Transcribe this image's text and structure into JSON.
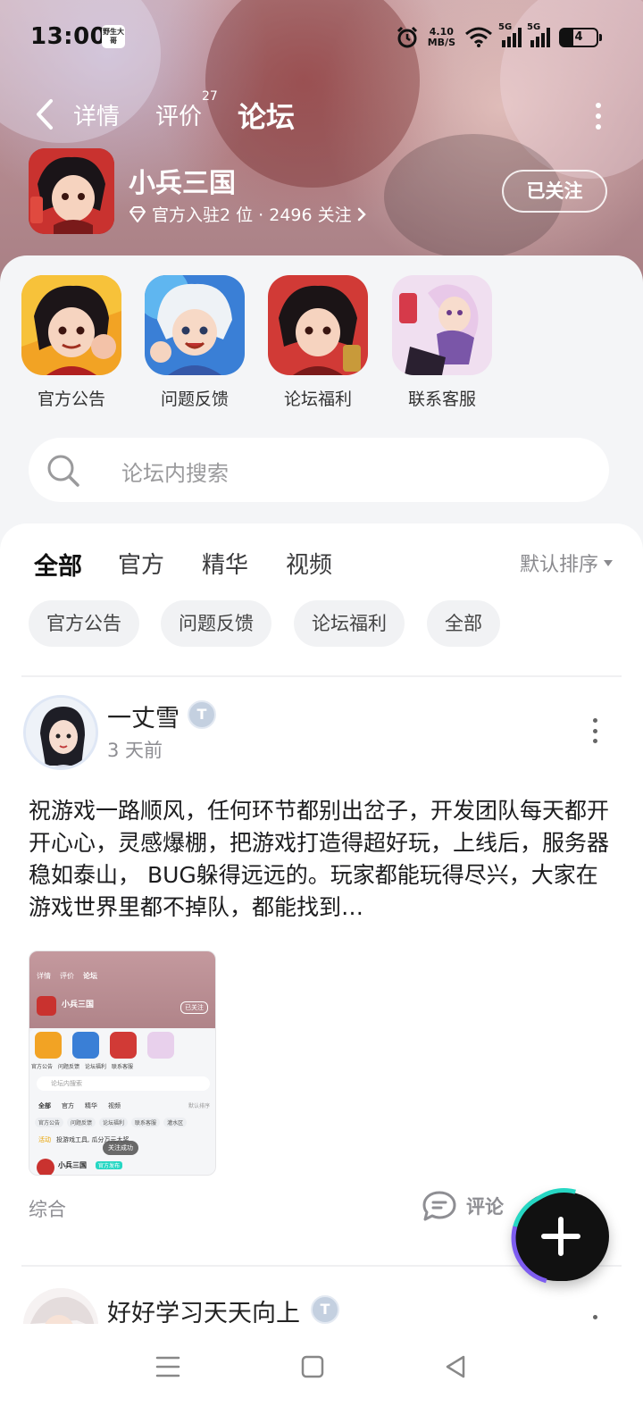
{
  "status_bar": {
    "time": "13:00",
    "app_icon_text": "野生大哥",
    "net_speed_value": "4.10",
    "net_speed_unit": "MB/S",
    "signal_1_tag": "5G",
    "signal_2_tag": "5G",
    "battery": "4"
  },
  "nav": {
    "tabs": [
      {
        "label": "详情"
      },
      {
        "label": "评价",
        "badge": "27"
      },
      {
        "label": "论坛"
      }
    ]
  },
  "game": {
    "title": "小兵三国",
    "meta": "官方入驻2 位 · 2496 关注",
    "follow_label": "已关注"
  },
  "shortcuts": [
    {
      "label": "官方公告",
      "icon": "hero-red-fist"
    },
    {
      "label": "问题反馈",
      "icon": "hero-white-hair"
    },
    {
      "label": "论坛福利",
      "icon": "hero-red-game-logo"
    },
    {
      "label": "联系客服",
      "icon": "hero-purple-girl"
    }
  ],
  "search": {
    "placeholder": "论坛内搜索"
  },
  "filters": {
    "tabs": [
      {
        "label": "全部"
      },
      {
        "label": "官方"
      },
      {
        "label": "精华"
      },
      {
        "label": "视频"
      }
    ],
    "sort_label": "默认排序",
    "chips": [
      {
        "label": "官方公告"
      },
      {
        "label": "问题反馈"
      },
      {
        "label": "论坛福利"
      },
      {
        "label": "全部"
      }
    ]
  },
  "posts": [
    {
      "author": "一丈雪",
      "time": "3 天前",
      "body": "祝游戏一路顺风，任何环节都别出岔子，开发团队每天都开开心心，灵感爆棚，把游戏打造得超好玩，上线后，服务器稳如泰山， BUG躲得远远的。玩家都能玩得尽兴，大家在游戏世界里都不掉队，都能找到…",
      "category": "综合",
      "comment_label": "评论",
      "thumb": {
        "title": "小兵三国",
        "tabs": [
          "详情",
          "评价",
          "论坛"
        ],
        "follow": "已关注",
        "shortcuts": [
          "官方公告",
          "问题反馈",
          "论坛福利",
          "联系客服"
        ],
        "search": "论坛内搜索",
        "filters": [
          "全部",
          "官方",
          "精华",
          "视频"
        ],
        "sort": "默认排序",
        "chips": [
          "官方公告",
          "问题反馈",
          "论坛福利",
          "联系客服",
          "灌水区"
        ],
        "activity_tag": "活动",
        "activity_text": "投游戏工具, 瓜分万元大奖",
        "toast": "关注成功",
        "row_author": "小兵三国",
        "row_badge": "官方发布"
      }
    },
    {
      "author": "好好学习天天向上",
      "time": "",
      "body": "",
      "category": "",
      "comment_label": ""
    }
  ],
  "colors": {
    "accent": "#26d7c3",
    "fab": "#111111",
    "header_bg": "#b98f94"
  }
}
